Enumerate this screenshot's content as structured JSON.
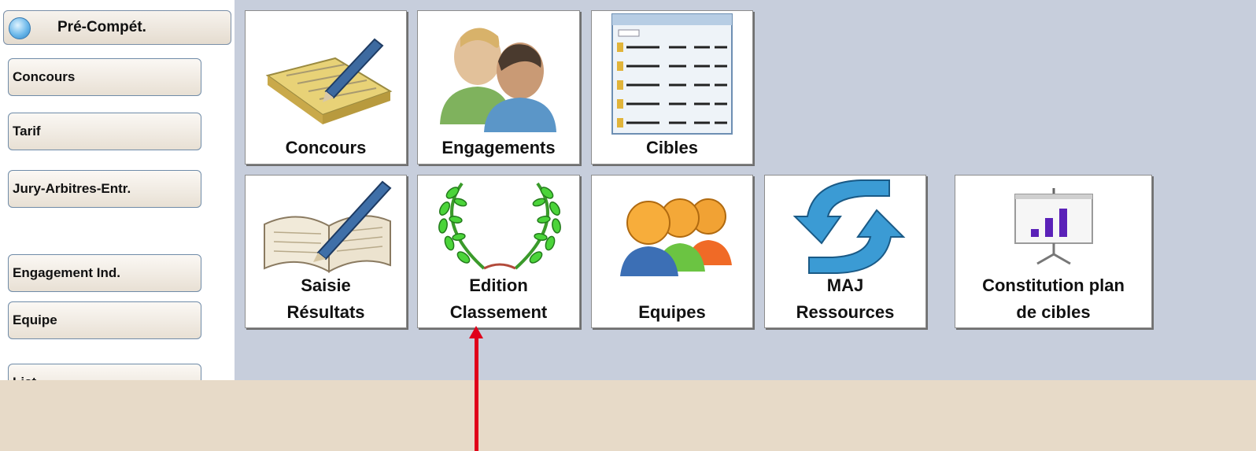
{
  "sidebar": {
    "header_label": "Pré-Compét.",
    "items": [
      {
        "label": "Concours"
      },
      {
        "label": "Tarif"
      },
      {
        "label": "Jury-Arbitres-Entr."
      },
      {
        "label": "Engagement Ind."
      },
      {
        "label": "Equipe"
      },
      {
        "label": "List"
      }
    ]
  },
  "tiles": {
    "concours": {
      "line1": "Concours",
      "icon": "notepad-pen-icon"
    },
    "engagements": {
      "line1": "Engagements",
      "icon": "people-icon"
    },
    "cibles": {
      "line1": "Cibles",
      "icon": "window-list-icon"
    },
    "saisie": {
      "line1": "Saisie",
      "line2": "Résultats",
      "icon": "book-pen-icon"
    },
    "edition": {
      "line1": "Edition",
      "line2": "Classement",
      "icon": "laurel-wreath-icon"
    },
    "equipes": {
      "line1": "Equipes",
      "icon": "team-icon"
    },
    "maj": {
      "line1": "MAJ",
      "line2": "Ressources",
      "icon": "refresh-arrows-icon"
    },
    "plan": {
      "line1": "Constitution plan",
      "line2": "de cibles",
      "icon": "presentation-chart-icon"
    }
  },
  "colors": {
    "annotation_arrow": "#e0001a",
    "workspace": "#c7cedc",
    "backdrop": "#e7dac8"
  }
}
